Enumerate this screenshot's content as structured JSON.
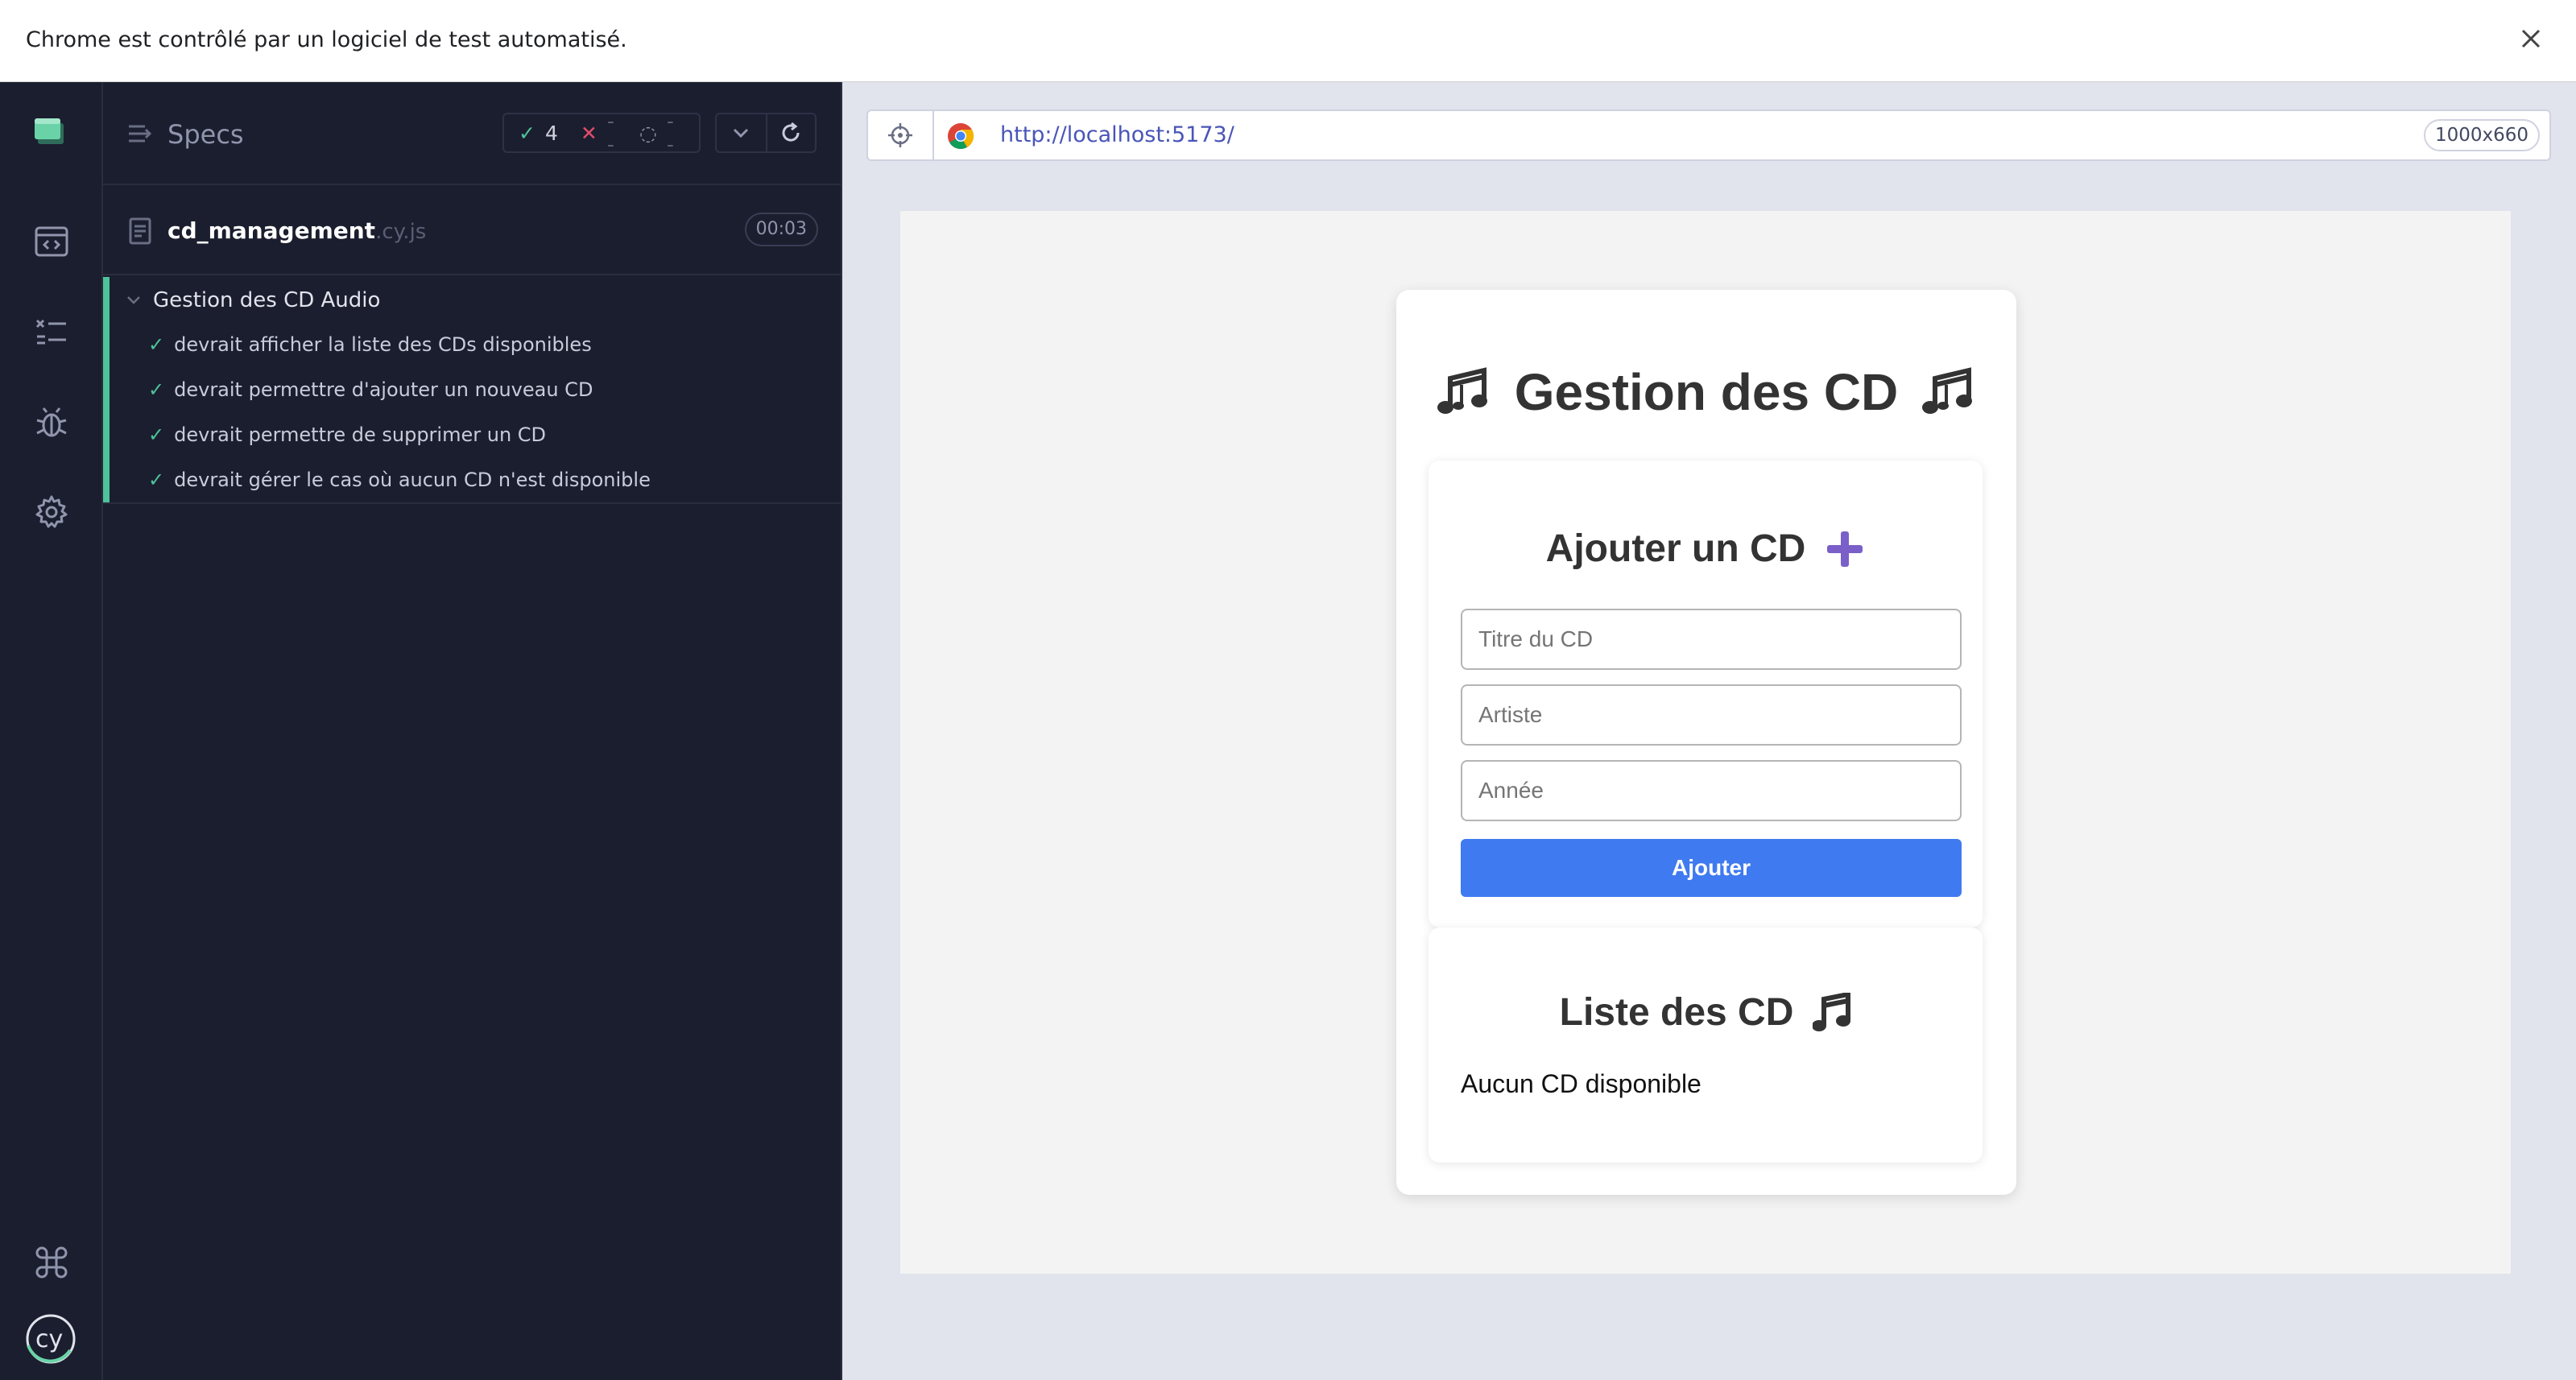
{
  "infobar": {
    "message": "Chrome est contrôlé par un logiciel de test automatisé."
  },
  "nav": {
    "items": [
      "logo-icon",
      "specs-nav-icon",
      "runs-nav-icon",
      "debug-nav-icon",
      "settings-nav-icon",
      "shortcuts-icon",
      "cypress-logo"
    ]
  },
  "specs": {
    "title": "Specs",
    "stats": {
      "passed": "4",
      "failed": "--",
      "pending": "--"
    },
    "file": {
      "name": "cd_management",
      "ext": ".cy.js",
      "duration": "00:03"
    },
    "suite": {
      "title": "Gestion des CD Audio",
      "tests": [
        "devrait afficher la liste des CDs disponibles",
        "devrait permettre d'ajouter un nouveau CD",
        "devrait permettre de supprimer un CD",
        "devrait gérer le cas où aucun CD n'est disponible"
      ]
    }
  },
  "browser": {
    "url": "http://localhost:5173/",
    "viewport_size": "1000x660"
  },
  "app": {
    "title": "Gestion des CD",
    "add_card": {
      "title": "Ajouter un CD",
      "title_placeholder": "Titre du CD",
      "artist_placeholder": "Artiste",
      "year_placeholder": "Année",
      "submit_label": "Ajouter"
    },
    "list_card": {
      "title": "Liste des CD",
      "empty_message": "Aucun CD disponible"
    }
  },
  "colors": {
    "pass": "#4ec29a",
    "fail": "#e04d6c",
    "accent_button": "#3f7af0",
    "plus_icon": "#7a5fc8"
  }
}
